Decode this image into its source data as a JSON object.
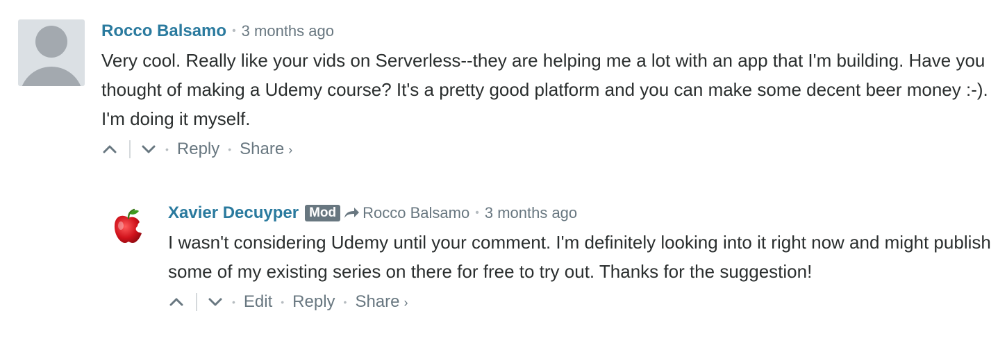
{
  "comments": [
    {
      "author": "Rocco Balsamo",
      "time": "3 months ago",
      "text": "Very cool. Really like your vids on Serverless--they are helping me a lot with an app that I'm building. Have you thought of making a Udemy course? It's a pretty good platform and you can make some decent beer money :-). I'm doing it myself.",
      "actions": {
        "reply": "Reply",
        "share": "Share",
        "share_chevron": "›"
      }
    },
    {
      "author": "Xavier Decuyper",
      "badge": "Mod",
      "in_reply_to": "Rocco Balsamo",
      "time": "3 months ago",
      "text": "I wasn't considering Udemy until your comment. I'm definitely looking into it right now and might publish some of my existing series on there for free to try out. Thanks for the suggestion!",
      "actions": {
        "edit": "Edit",
        "reply": "Reply",
        "share": "Share",
        "share_chevron": "›"
      }
    }
  ],
  "separators": {
    "bullet": "•"
  },
  "icons": {
    "default_avatar": "default-avatar-icon",
    "apple_avatar": "apple-avatar-icon",
    "upvote": "chevron-up-icon",
    "downvote": "chevron-down-icon",
    "reply_to": "reply-arrow-icon"
  },
  "colors": {
    "author": "#2a7a9e",
    "meta": "#687780",
    "text": "#2a2e2e",
    "badge_bg": "#687780",
    "avatar_bg": "#dbe0e4",
    "avatar_fg": "#a3a9af"
  }
}
